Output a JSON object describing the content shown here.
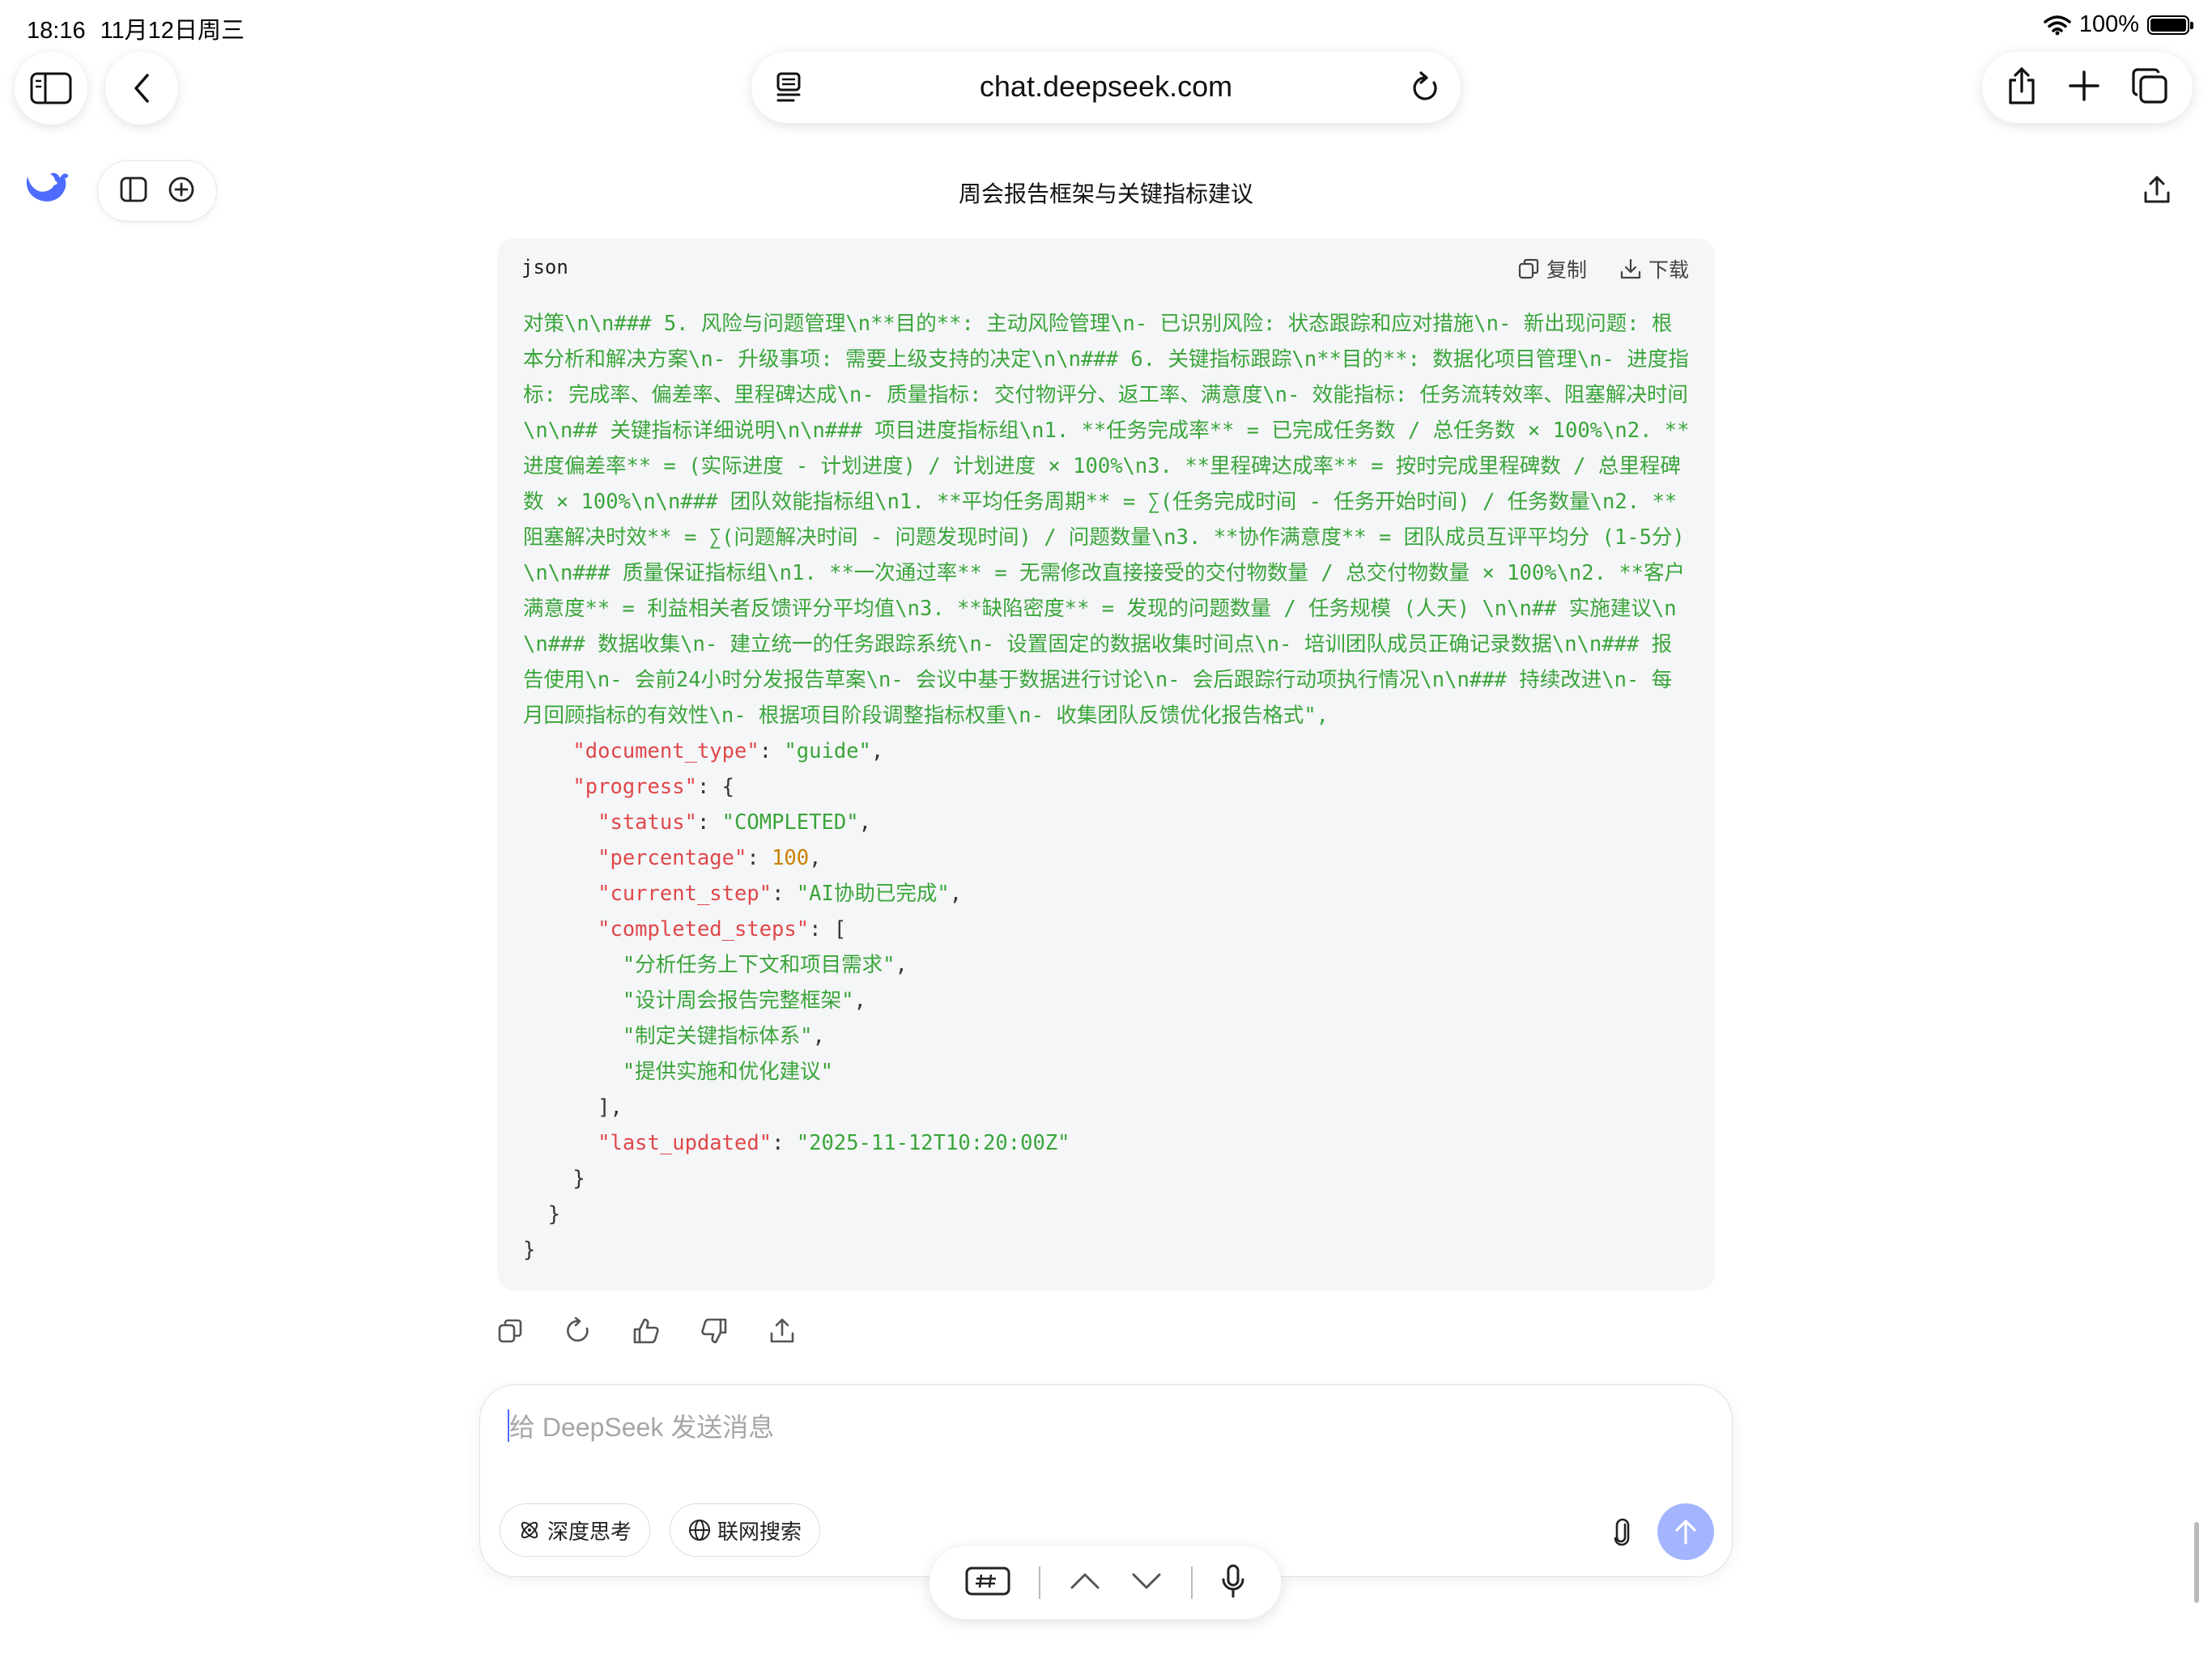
{
  "status_bar": {
    "time": "18:16",
    "date": "11月12日周三",
    "battery": "100%"
  },
  "browser": {
    "url": "chat.deepseek.com"
  },
  "chat": {
    "title": "周会报告框架与关键指标建议"
  },
  "code_block": {
    "language": "json",
    "copy_label": "复制",
    "download_label": "下载",
    "content_string": "对策\\n\\n### 5. 风险与问题管理\\n**目的**: 主动风险管理\\n- 已识别风险: 状态跟踪和应对措施\\n- 新出现问题: 根本分析和解决方案\\n- 升级事项: 需要上级支持的决定\\n\\n### 6. 关键指标跟踪\\n**目的**: 数据化项目管理\\n- 进度指标: 完成率、偏差率、里程碑达成\\n- 质量指标: 交付物评分、返工率、满意度\\n- 效能指标: 任务流转效率、阻塞解决时间\\n\\n## 关键指标详细说明\\n\\n### 项目进度指标组\\n1. **任务完成率** = 已完成任务数 / 总任务数 × 100%\\n2. **进度偏差率** = (实际进度 - 计划进度) / 计划进度 × 100%\\n3. **里程碑达成率** = 按时完成里程碑数 / 总里程碑数 × 100%\\n\\n### 团队效能指标组\\n1. **平均任务周期** = ∑(任务完成时间 - 任务开始时间) / 任务数量\\n2. **阻塞解决时效** = ∑(问题解决时间 - 问题发现时间) / 问题数量\\n3. **协作满意度** = 团队成员互评平均分 (1-5分) \\n\\n### 质量保证指标组\\n1. **一次通过率** = 无需修改直接接受的交付物数量 / 总交付物数量 × 100%\\n2. **客户满意度** = 利益相关者反馈评分平均值\\n3. **缺陷密度** = 发现的问题数量 / 任务规模 (人天) \\n\\n## 实施建议\\n\\n### 数据收集\\n- 建立统一的任务跟踪系统\\n- 设置固定的数据收集时间点\\n- 培训团队成员正确记录数据\\n\\n### 报告使用\\n- 会前24小时分发报告草案\\n- 会议中基于数据进行讨论\\n- 会后跟踪行动项执行情况\\n\\n### 持续改进\\n- 每月回顾指标的有效性\\n- 根据项目阶段调整指标权重\\n- 收集团队反馈优化报告格式\",",
    "document_type_key": "\"document_type\"",
    "document_type_value": "\"guide\"",
    "progress_key": "\"progress\"",
    "status_key": "\"status\"",
    "status_value": "\"COMPLETED\"",
    "percentage_key": "\"percentage\"",
    "percentage_value": "100",
    "current_step_key": "\"current_step\"",
    "current_step_value": "\"AI协助已完成\"",
    "completed_steps_key": "\"completed_steps\"",
    "completed_steps": [
      "\"分析任务上下文和项目需求\"",
      "\"设计周会报告完整框架\"",
      "\"制定关键指标体系\"",
      "\"提供实施和优化建议\""
    ],
    "last_updated_key": "\"last_updated\"",
    "last_updated_value": "\"2025-11-12T10:20:00Z\""
  },
  "input": {
    "placeholder": "给 DeepSeek 发送消息",
    "deep_think_label": "深度思考",
    "web_search_label": "联网搜索"
  },
  "colors": {
    "accent": "#4d6bfe",
    "send_disabled": "#a3b5ff",
    "json_key": "#e0484a",
    "json_string": "#3aa53a",
    "json_number": "#c98000"
  }
}
